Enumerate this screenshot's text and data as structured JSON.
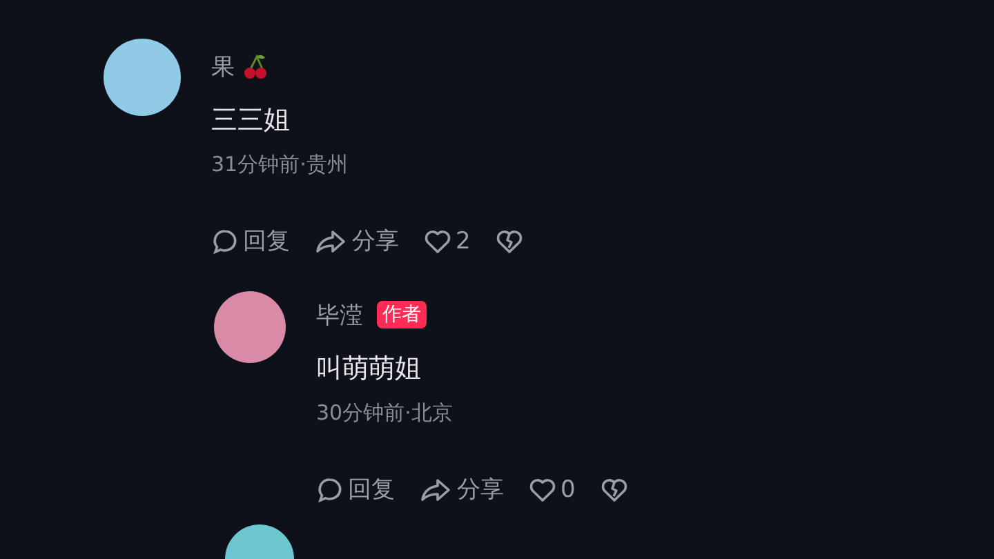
{
  "comments": [
    {
      "name": "果",
      "name_emoji": true,
      "author": false,
      "text": "三三姐",
      "meta": "31分钟前·贵州",
      "actions": {
        "reply": "回复",
        "share": "分享",
        "likes": "2"
      },
      "replies": [
        {
          "name": "毕滢",
          "name_emoji": false,
          "author": true,
          "author_label": "作者",
          "text": "叫萌萌姐",
          "meta": "30分钟前·北京",
          "actions": {
            "reply": "回复",
            "share": "分享",
            "likes": "0"
          }
        }
      ]
    }
  ]
}
